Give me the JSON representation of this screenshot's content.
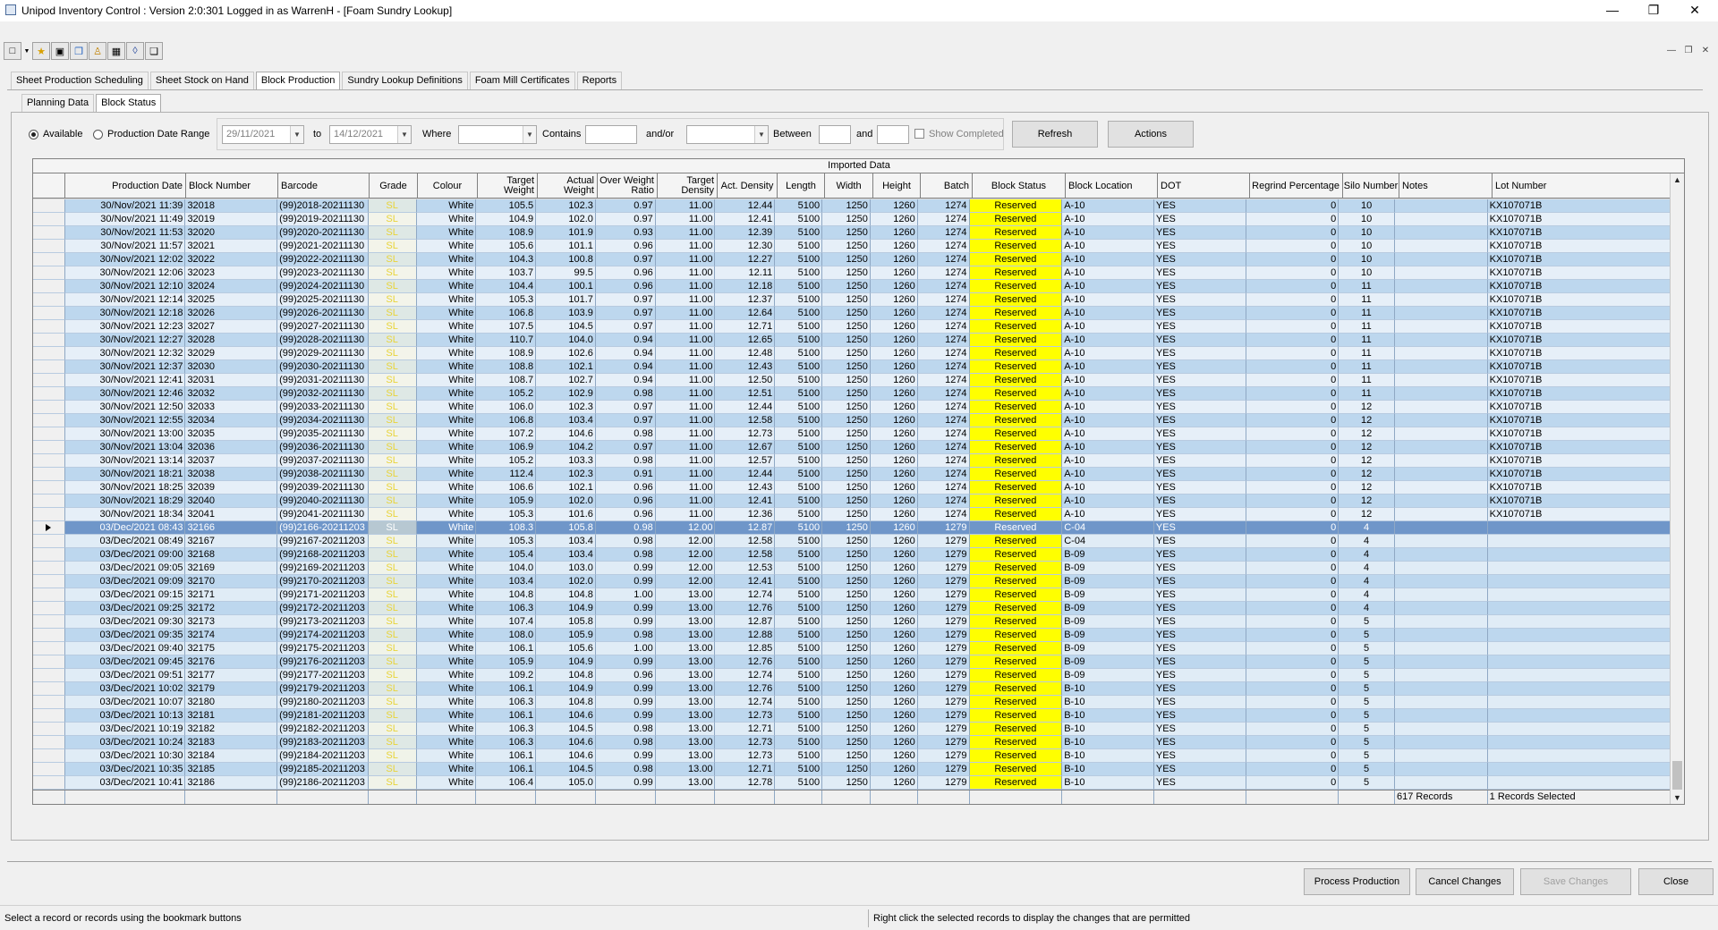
{
  "window": {
    "title": "Unipod Inventory Control : Version 2:0:301 Logged in as WarrenH - [Foam Sundry Lookup]"
  },
  "tabs": [
    "Sheet Production Scheduling",
    "Sheet Stock on Hand",
    "Block Production",
    "Sundry Lookup Definitions",
    "Foam Mill Certificates",
    "Reports"
  ],
  "subtabs": [
    "Planning Data",
    "Block Status"
  ],
  "filter": {
    "available": "Available",
    "range": "Production Date Range",
    "from": "29/11/2021",
    "to_label": "to",
    "to": "14/12/2021",
    "where": "Where",
    "contains": "Contains",
    "andor": "and/or",
    "between": "Between",
    "and": "and",
    "show_completed": "Show Completed",
    "refresh": "Refresh",
    "actions": "Actions"
  },
  "grid": {
    "group_header": "Imported Data",
    "columns": [
      "Production Date",
      "Block Number",
      "Barcode",
      "Grade",
      "Colour",
      "Target Weight",
      "Actual Weight",
      "Over Weight Ratio",
      "Target Density",
      "Act. Density",
      "Length",
      "Width",
      "Height",
      "Batch",
      "Block Status",
      "Block Location",
      "DOT",
      "Regrind Percentage",
      "Silo Number",
      "Notes",
      "Lot Number"
    ],
    "rows": [
      [
        "30/Nov/2021 11:39",
        "32018",
        "(99)2018-20211130",
        "SL",
        "White",
        "105.5",
        "102.3",
        "0.97",
        "11.00",
        "12.44",
        "5100",
        "1250",
        "1260",
        "1274",
        "Reserved",
        "A-10",
        "YES",
        "0",
        "10",
        "",
        "KX107071B"
      ],
      [
        "30/Nov/2021 11:49",
        "32019",
        "(99)2019-20211130",
        "SL",
        "White",
        "104.9",
        "102.0",
        "0.97",
        "11.00",
        "12.41",
        "5100",
        "1250",
        "1260",
        "1274",
        "Reserved",
        "A-10",
        "YES",
        "0",
        "10",
        "",
        "KX107071B"
      ],
      [
        "30/Nov/2021 11:53",
        "32020",
        "(99)2020-20211130",
        "SL",
        "White",
        "108.9",
        "101.9",
        "0.93",
        "11.00",
        "12.39",
        "5100",
        "1250",
        "1260",
        "1274",
        "Reserved",
        "A-10",
        "YES",
        "0",
        "10",
        "",
        "KX107071B"
      ],
      [
        "30/Nov/2021 11:57",
        "32021",
        "(99)2021-20211130",
        "SL",
        "White",
        "105.6",
        "101.1",
        "0.96",
        "11.00",
        "12.30",
        "5100",
        "1250",
        "1260",
        "1274",
        "Reserved",
        "A-10",
        "YES",
        "0",
        "10",
        "",
        "KX107071B"
      ],
      [
        "30/Nov/2021 12:02",
        "32022",
        "(99)2022-20211130",
        "SL",
        "White",
        "104.3",
        "100.8",
        "0.97",
        "11.00",
        "12.27",
        "5100",
        "1250",
        "1260",
        "1274",
        "Reserved",
        "A-10",
        "YES",
        "0",
        "10",
        "",
        "KX107071B"
      ],
      [
        "30/Nov/2021 12:06",
        "32023",
        "(99)2023-20211130",
        "SL",
        "White",
        "103.7",
        "99.5",
        "0.96",
        "11.00",
        "12.11",
        "5100",
        "1250",
        "1260",
        "1274",
        "Reserved",
        "A-10",
        "YES",
        "0",
        "10",
        "",
        "KX107071B"
      ],
      [
        "30/Nov/2021 12:10",
        "32024",
        "(99)2024-20211130",
        "SL",
        "White",
        "104.4",
        "100.1",
        "0.96",
        "11.00",
        "12.18",
        "5100",
        "1250",
        "1260",
        "1274",
        "Reserved",
        "A-10",
        "YES",
        "0",
        "11",
        "",
        "KX107071B"
      ],
      [
        "30/Nov/2021 12:14",
        "32025",
        "(99)2025-20211130",
        "SL",
        "White",
        "105.3",
        "101.7",
        "0.97",
        "11.00",
        "12.37",
        "5100",
        "1250",
        "1260",
        "1274",
        "Reserved",
        "A-10",
        "YES",
        "0",
        "11",
        "",
        "KX107071B"
      ],
      [
        "30/Nov/2021 12:18",
        "32026",
        "(99)2026-20211130",
        "SL",
        "White",
        "106.8",
        "103.9",
        "0.97",
        "11.00",
        "12.64",
        "5100",
        "1250",
        "1260",
        "1274",
        "Reserved",
        "A-10",
        "YES",
        "0",
        "11",
        "",
        "KX107071B"
      ],
      [
        "30/Nov/2021 12:23",
        "32027",
        "(99)2027-20211130",
        "SL",
        "White",
        "107.5",
        "104.5",
        "0.97",
        "11.00",
        "12.71",
        "5100",
        "1250",
        "1260",
        "1274",
        "Reserved",
        "A-10",
        "YES",
        "0",
        "11",
        "",
        "KX107071B"
      ],
      [
        "30/Nov/2021 12:27",
        "32028",
        "(99)2028-20211130",
        "SL",
        "White",
        "110.7",
        "104.0",
        "0.94",
        "11.00",
        "12.65",
        "5100",
        "1250",
        "1260",
        "1274",
        "Reserved",
        "A-10",
        "YES",
        "0",
        "11",
        "",
        "KX107071B"
      ],
      [
        "30/Nov/2021 12:32",
        "32029",
        "(99)2029-20211130",
        "SL",
        "White",
        "108.9",
        "102.6",
        "0.94",
        "11.00",
        "12.48",
        "5100",
        "1250",
        "1260",
        "1274",
        "Reserved",
        "A-10",
        "YES",
        "0",
        "11",
        "",
        "KX107071B"
      ],
      [
        "30/Nov/2021 12:37",
        "32030",
        "(99)2030-20211130",
        "SL",
        "White",
        "108.8",
        "102.1",
        "0.94",
        "11.00",
        "12.43",
        "5100",
        "1250",
        "1260",
        "1274",
        "Reserved",
        "A-10",
        "YES",
        "0",
        "11",
        "",
        "KX107071B"
      ],
      [
        "30/Nov/2021 12:41",
        "32031",
        "(99)2031-20211130",
        "SL",
        "White",
        "108.7",
        "102.7",
        "0.94",
        "11.00",
        "12.50",
        "5100",
        "1250",
        "1260",
        "1274",
        "Reserved",
        "A-10",
        "YES",
        "0",
        "11",
        "",
        "KX107071B"
      ],
      [
        "30/Nov/2021 12:46",
        "32032",
        "(99)2032-20211130",
        "SL",
        "White",
        "105.2",
        "102.9",
        "0.98",
        "11.00",
        "12.51",
        "5100",
        "1250",
        "1260",
        "1274",
        "Reserved",
        "A-10",
        "YES",
        "0",
        "11",
        "",
        "KX107071B"
      ],
      [
        "30/Nov/2021 12:50",
        "32033",
        "(99)2033-20211130",
        "SL",
        "White",
        "106.0",
        "102.3",
        "0.97",
        "11.00",
        "12.44",
        "5100",
        "1250",
        "1260",
        "1274",
        "Reserved",
        "A-10",
        "YES",
        "0",
        "12",
        "",
        "KX107071B"
      ],
      [
        "30/Nov/2021 12:55",
        "32034",
        "(99)2034-20211130",
        "SL",
        "White",
        "106.8",
        "103.4",
        "0.97",
        "11.00",
        "12.58",
        "5100",
        "1250",
        "1260",
        "1274",
        "Reserved",
        "A-10",
        "YES",
        "0",
        "12",
        "",
        "KX107071B"
      ],
      [
        "30/Nov/2021 13:00",
        "32035",
        "(99)2035-20211130",
        "SL",
        "White",
        "107.2",
        "104.6",
        "0.98",
        "11.00",
        "12.73",
        "5100",
        "1250",
        "1260",
        "1274",
        "Reserved",
        "A-10",
        "YES",
        "0",
        "12",
        "",
        "KX107071B"
      ],
      [
        "30/Nov/2021 13:04",
        "32036",
        "(99)2036-20211130",
        "SL",
        "White",
        "106.9",
        "104.2",
        "0.97",
        "11.00",
        "12.67",
        "5100",
        "1250",
        "1260",
        "1274",
        "Reserved",
        "A-10",
        "YES",
        "0",
        "12",
        "",
        "KX107071B"
      ],
      [
        "30/Nov/2021 13:14",
        "32037",
        "(99)2037-20211130",
        "SL",
        "White",
        "105.2",
        "103.3",
        "0.98",
        "11.00",
        "12.57",
        "5100",
        "1250",
        "1260",
        "1274",
        "Reserved",
        "A-10",
        "YES",
        "0",
        "12",
        "",
        "KX107071B"
      ],
      [
        "30/Nov/2021 18:21",
        "32038",
        "(99)2038-20211130",
        "SL",
        "White",
        "112.4",
        "102.3",
        "0.91",
        "11.00",
        "12.44",
        "5100",
        "1250",
        "1260",
        "1274",
        "Reserved",
        "A-10",
        "YES",
        "0",
        "12",
        "",
        "KX107071B"
      ],
      [
        "30/Nov/2021 18:25",
        "32039",
        "(99)2039-20211130",
        "SL",
        "White",
        "106.6",
        "102.1",
        "0.96",
        "11.00",
        "12.43",
        "5100",
        "1250",
        "1260",
        "1274",
        "Reserved",
        "A-10",
        "YES",
        "0",
        "12",
        "",
        "KX107071B"
      ],
      [
        "30/Nov/2021 18:29",
        "32040",
        "(99)2040-20211130",
        "SL",
        "White",
        "105.9",
        "102.0",
        "0.96",
        "11.00",
        "12.41",
        "5100",
        "1250",
        "1260",
        "1274",
        "Reserved",
        "A-10",
        "YES",
        "0",
        "12",
        "",
        "KX107071B"
      ],
      [
        "30/Nov/2021 18:34",
        "32041",
        "(99)2041-20211130",
        "SL",
        "White",
        "105.3",
        "101.6",
        "0.96",
        "11.00",
        "12.36",
        "5100",
        "1250",
        "1260",
        "1274",
        "Reserved",
        "A-10",
        "YES",
        "0",
        "12",
        "",
        "KX107071B"
      ],
      [
        "03/Dec/2021 08:43",
        "32166",
        "(99)2166-20211203",
        "SL",
        "White",
        "108.3",
        "105.8",
        "0.98",
        "12.00",
        "12.87",
        "5100",
        "1250",
        "1260",
        "1279",
        "Reserved",
        "C-04",
        "YES",
        "0",
        "4",
        "",
        ""
      ],
      [
        "03/Dec/2021 08:49",
        "32167",
        "(99)2167-20211203",
        "SL",
        "White",
        "105.3",
        "103.4",
        "0.98",
        "12.00",
        "12.58",
        "5100",
        "1250",
        "1260",
        "1279",
        "Reserved",
        "C-04",
        "YES",
        "0",
        "4",
        "",
        ""
      ],
      [
        "03/Dec/2021 09:00",
        "32168",
        "(99)2168-20211203",
        "SL",
        "White",
        "105.4",
        "103.4",
        "0.98",
        "12.00",
        "12.58",
        "5100",
        "1250",
        "1260",
        "1279",
        "Reserved",
        "B-09",
        "YES",
        "0",
        "4",
        "",
        ""
      ],
      [
        "03/Dec/2021 09:05",
        "32169",
        "(99)2169-20211203",
        "SL",
        "White",
        "104.0",
        "103.0",
        "0.99",
        "12.00",
        "12.53",
        "5100",
        "1250",
        "1260",
        "1279",
        "Reserved",
        "B-09",
        "YES",
        "0",
        "4",
        "",
        ""
      ],
      [
        "03/Dec/2021 09:09",
        "32170",
        "(99)2170-20211203",
        "SL",
        "White",
        "103.4",
        "102.0",
        "0.99",
        "12.00",
        "12.41",
        "5100",
        "1250",
        "1260",
        "1279",
        "Reserved",
        "B-09",
        "YES",
        "0",
        "4",
        "",
        ""
      ],
      [
        "03/Dec/2021 09:15",
        "32171",
        "(99)2171-20211203",
        "SL",
        "White",
        "104.8",
        "104.8",
        "1.00",
        "13.00",
        "12.74",
        "5100",
        "1250",
        "1260",
        "1279",
        "Reserved",
        "B-09",
        "YES",
        "0",
        "4",
        "",
        ""
      ],
      [
        "03/Dec/2021 09:25",
        "32172",
        "(99)2172-20211203",
        "SL",
        "White",
        "106.3",
        "104.9",
        "0.99",
        "13.00",
        "12.76",
        "5100",
        "1250",
        "1260",
        "1279",
        "Reserved",
        "B-09",
        "YES",
        "0",
        "4",
        "",
        ""
      ],
      [
        "03/Dec/2021 09:30",
        "32173",
        "(99)2173-20211203",
        "SL",
        "White",
        "107.4",
        "105.8",
        "0.99",
        "13.00",
        "12.87",
        "5100",
        "1250",
        "1260",
        "1279",
        "Reserved",
        "B-09",
        "YES",
        "0",
        "5",
        "",
        ""
      ],
      [
        "03/Dec/2021 09:35",
        "32174",
        "(99)2174-20211203",
        "SL",
        "White",
        "108.0",
        "105.9",
        "0.98",
        "13.00",
        "12.88",
        "5100",
        "1250",
        "1260",
        "1279",
        "Reserved",
        "B-09",
        "YES",
        "0",
        "5",
        "",
        ""
      ],
      [
        "03/Dec/2021 09:40",
        "32175",
        "(99)2175-20211203",
        "SL",
        "White",
        "106.1",
        "105.6",
        "1.00",
        "13.00",
        "12.85",
        "5100",
        "1250",
        "1260",
        "1279",
        "Reserved",
        "B-09",
        "YES",
        "0",
        "5",
        "",
        ""
      ],
      [
        "03/Dec/2021 09:45",
        "32176",
        "(99)2176-20211203",
        "SL",
        "White",
        "105.9",
        "104.9",
        "0.99",
        "13.00",
        "12.76",
        "5100",
        "1250",
        "1260",
        "1279",
        "Reserved",
        "B-09",
        "YES",
        "0",
        "5",
        "",
        ""
      ],
      [
        "03/Dec/2021 09:51",
        "32177",
        "(99)2177-20211203",
        "SL",
        "White",
        "109.2",
        "104.8",
        "0.96",
        "13.00",
        "12.74",
        "5100",
        "1250",
        "1260",
        "1279",
        "Reserved",
        "B-09",
        "YES",
        "0",
        "5",
        "",
        ""
      ],
      [
        "03/Dec/2021 10:02",
        "32179",
        "(99)2179-20211203",
        "SL",
        "White",
        "106.1",
        "104.9",
        "0.99",
        "13.00",
        "12.76",
        "5100",
        "1250",
        "1260",
        "1279",
        "Reserved",
        "B-10",
        "YES",
        "0",
        "5",
        "",
        ""
      ],
      [
        "03/Dec/2021 10:07",
        "32180",
        "(99)2180-20211203",
        "SL",
        "White",
        "106.3",
        "104.8",
        "0.99",
        "13.00",
        "12.74",
        "5100",
        "1250",
        "1260",
        "1279",
        "Reserved",
        "B-10",
        "YES",
        "0",
        "5",
        "",
        ""
      ],
      [
        "03/Dec/2021 10:13",
        "32181",
        "(99)2181-20211203",
        "SL",
        "White",
        "106.1",
        "104.6",
        "0.99",
        "13.00",
        "12.73",
        "5100",
        "1250",
        "1260",
        "1279",
        "Reserved",
        "B-10",
        "YES",
        "0",
        "5",
        "",
        ""
      ],
      [
        "03/Dec/2021 10:19",
        "32182",
        "(99)2182-20211203",
        "SL",
        "White",
        "106.3",
        "104.5",
        "0.98",
        "13.00",
        "12.71",
        "5100",
        "1250",
        "1260",
        "1279",
        "Reserved",
        "B-10",
        "YES",
        "0",
        "5",
        "",
        ""
      ],
      [
        "03/Dec/2021 10:24",
        "32183",
        "(99)2183-20211203",
        "SL",
        "White",
        "106.3",
        "104.6",
        "0.98",
        "13.00",
        "12.73",
        "5100",
        "1250",
        "1260",
        "1279",
        "Reserved",
        "B-10",
        "YES",
        "0",
        "5",
        "",
        ""
      ],
      [
        "03/Dec/2021 10:30",
        "32184",
        "(99)2184-20211203",
        "SL",
        "White",
        "106.1",
        "104.6",
        "0.99",
        "13.00",
        "12.73",
        "5100",
        "1250",
        "1260",
        "1279",
        "Reserved",
        "B-10",
        "YES",
        "0",
        "5",
        "",
        ""
      ],
      [
        "03/Dec/2021 10:35",
        "32185",
        "(99)2185-20211203",
        "SL",
        "White",
        "106.1",
        "104.5",
        "0.98",
        "13.00",
        "12.71",
        "5100",
        "1250",
        "1260",
        "1279",
        "Reserved",
        "B-10",
        "YES",
        "0",
        "5",
        "",
        ""
      ],
      [
        "03/Dec/2021 10:41",
        "32186",
        "(99)2186-20211203",
        "SL",
        "White",
        "106.4",
        "105.0",
        "0.99",
        "13.00",
        "12.78",
        "5100",
        "1250",
        "1260",
        "1279",
        "Reserved",
        "B-10",
        "YES",
        "0",
        "5",
        "",
        ""
      ]
    ],
    "selected_row": 24,
    "record_count": "617 Records",
    "selected_count": "1 Records Selected"
  },
  "buttons": {
    "process": "Process Production",
    "cancel": "Cancel Changes",
    "save": "Save Changes",
    "close": "Close"
  },
  "statusbar": {
    "left": "Select a record or records using the bookmark buttons",
    "right": "Right click the selected records to display the changes that are permitted"
  },
  "colors": {
    "row_even": "#bdd7ee",
    "row_odd": "#e6eff8",
    "selected_row": "#6f96c9",
    "status_reserved": "#ffff00",
    "grade_text": "#e8d43a"
  },
  "icons": [
    "app-icon",
    "new-doc-icon",
    "dropdown-icon",
    "star-icon",
    "image-icon",
    "copy-icon",
    "person-icon",
    "calculator-icon",
    "box-icon",
    "pages-icon"
  ]
}
